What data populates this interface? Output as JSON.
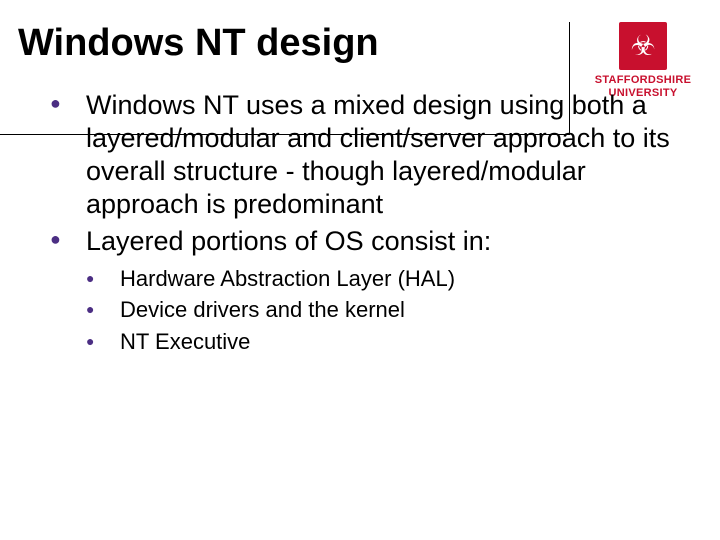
{
  "header": {
    "title": "Windows NT design",
    "logo_line1": "STAFFORDSHIRE",
    "logo_line2": "UNIVERSITY"
  },
  "bullets": {
    "item0": "Windows NT uses a mixed design  using both a layered/modular and client/server approach to its overall structure - though layered/modular approach is predominant",
    "item1": "Layered portions of OS consist in:"
  },
  "sub": {
    "s0": "Hardware Abstraction Layer (HAL)",
    "s1": "Device drivers and the kernel",
    "s2": "NT Executive"
  }
}
